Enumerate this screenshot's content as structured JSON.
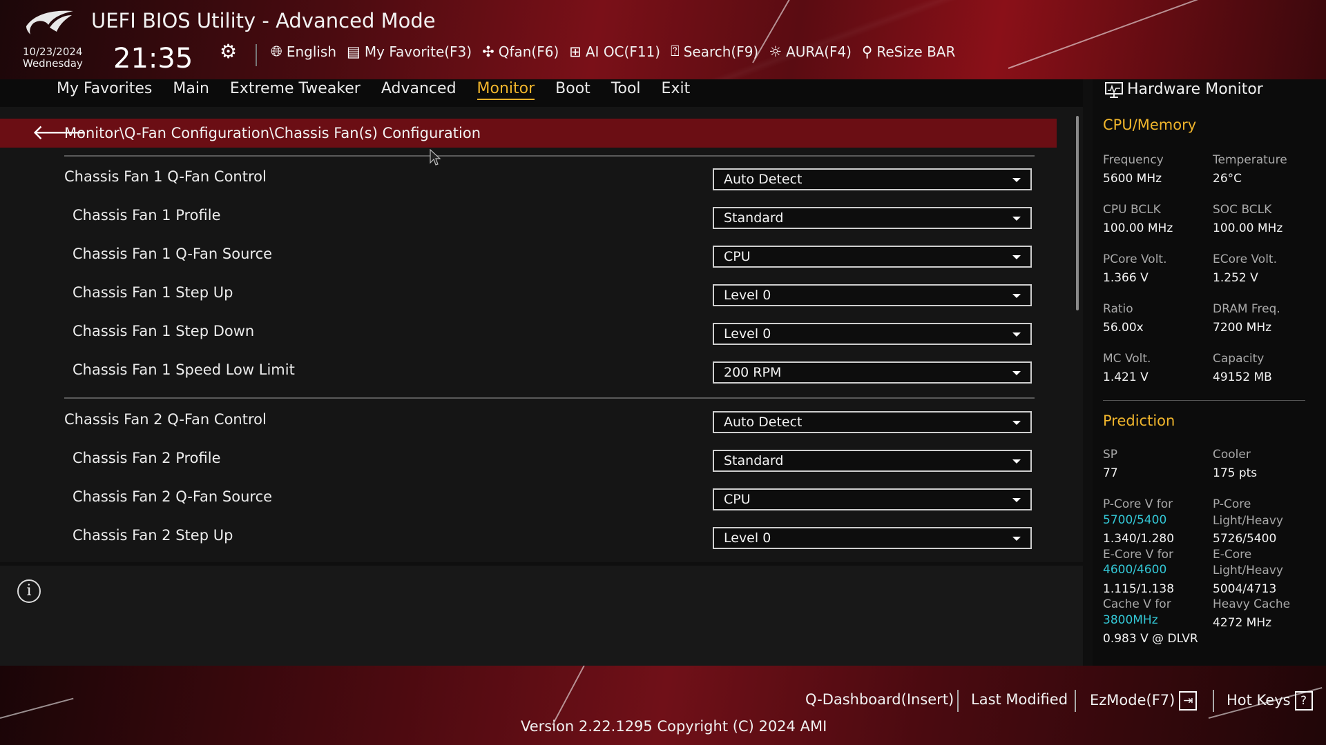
{
  "header": {
    "title": "UEFI BIOS Utility - Advanced Mode",
    "date": "10/23/2024",
    "weekday": "Wednesday",
    "time": "21:35",
    "tools": [
      {
        "label": "English",
        "icon": "globe-icon"
      },
      {
        "label": "My Favorite(F3)",
        "icon": "favorite-list-icon"
      },
      {
        "label": "Qfan(F6)",
        "icon": "fan-icon"
      },
      {
        "label": "AI OC(F11)",
        "icon": "ai-chip-icon"
      },
      {
        "label": "Search(F9)",
        "icon": "search-help-icon"
      },
      {
        "label": "AURA(F4)",
        "icon": "aura-light-icon"
      },
      {
        "label": "ReSize BAR",
        "icon": "resize-bar-icon"
      }
    ]
  },
  "menu": {
    "items": [
      "My Favorites",
      "Main",
      "Extreme Tweaker",
      "Advanced",
      "Monitor",
      "Boot",
      "Tool",
      "Exit"
    ],
    "active": "Monitor"
  },
  "breadcrumb": "Monitor\\Q-Fan Configuration\\Chassis Fan(s) Configuration",
  "settings": [
    {
      "label": "Chassis Fan 1 Q-Fan Control",
      "value": "Auto Detect"
    },
    {
      "label": "Chassis Fan 1 Profile",
      "value": "Standard"
    },
    {
      "label": "Chassis Fan 1 Q-Fan Source",
      "value": "CPU"
    },
    {
      "label": "Chassis Fan 1 Step Up",
      "value": "Level 0"
    },
    {
      "label": "Chassis Fan 1 Step Down",
      "value": "Level 0"
    },
    {
      "label": "Chassis Fan 1 Speed Low Limit",
      "value": "200 RPM"
    },
    {
      "label": "Chassis Fan 2 Q-Fan Control",
      "value": "Auto Detect"
    },
    {
      "label": "Chassis Fan 2 Profile",
      "value": "Standard"
    },
    {
      "label": "Chassis Fan 2 Q-Fan Source",
      "value": "CPU"
    },
    {
      "label": "Chassis Fan 2 Step Up",
      "value": "Level 0"
    }
  ],
  "hw": {
    "title": "Hardware Monitor",
    "cpu_section": "CPU/Memory",
    "cpu": [
      {
        "label": "Frequency",
        "value": "5600 MHz"
      },
      {
        "label": "Temperature",
        "value": "26°C"
      },
      {
        "label": "CPU BCLK",
        "value": "100.00 MHz"
      },
      {
        "label": "SOC BCLK",
        "value": "100.00 MHz"
      },
      {
        "label": "PCore Volt.",
        "value": "1.366 V"
      },
      {
        "label": "ECore Volt.",
        "value": "1.252 V"
      },
      {
        "label": "Ratio",
        "value": "56.00x"
      },
      {
        "label": "DRAM Freq.",
        "value": "7200 MHz"
      },
      {
        "label": "MC Volt.",
        "value": "1.421 V"
      },
      {
        "label": "Capacity",
        "value": "49152 MB"
      }
    ],
    "prediction_section": "Prediction",
    "sp_label": "SP",
    "sp_value": "77",
    "cooler_label": "Cooler",
    "cooler_value": "175 pts",
    "pcore_v_label": "P-Core V for",
    "pcore_v_freq": "5700/5400",
    "pcore_v_value": "1.340/1.280",
    "pcore_lh_label1": "P-Core",
    "pcore_lh_label2": "Light/Heavy",
    "pcore_lh_value": "5726/5400",
    "ecore_v_label": "E-Core V for",
    "ecore_v_freq": "4600/4600",
    "ecore_v_value": "1.115/1.138",
    "ecore_lh_label1": "E-Core",
    "ecore_lh_label2": "Light/Heavy",
    "ecore_lh_value": "5004/4713",
    "cache_v_label": "Cache V for",
    "cache_v_freq": "3800MHz",
    "cache_v_value": "0.983 V @ DLVR",
    "heavy_cache_label": "Heavy Cache",
    "heavy_cache_value": "4272 MHz"
  },
  "footer": {
    "qdashboard": "Q-Dashboard(Insert)",
    "last_modified": "Last Modified",
    "ezmode": "EzMode(F7)",
    "hotkeys": "Hot Keys",
    "hotkeys_box": "?",
    "version": "Version 2.22.1295 Copyright (C) 2024 AMI"
  },
  "colors": {
    "accent": "#f0b52c",
    "breadcrumb_bg": "#6b0e14",
    "cyan": "#33c8d6"
  }
}
